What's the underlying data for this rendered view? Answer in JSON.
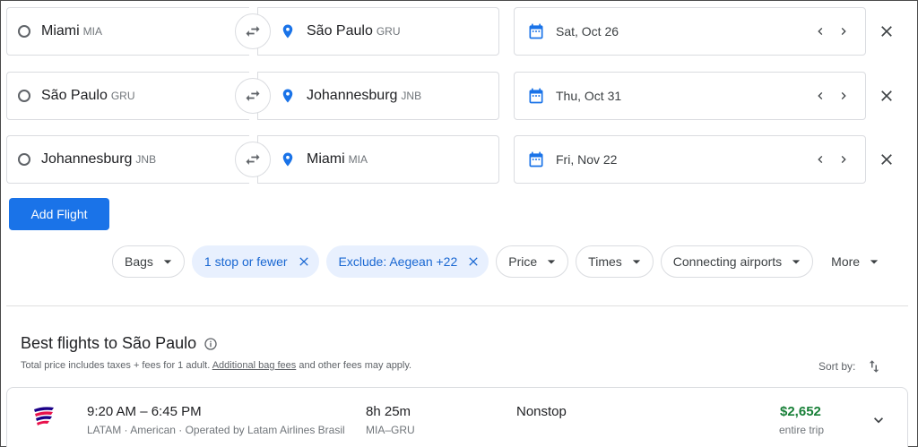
{
  "legs": [
    {
      "origin_city": "Miami",
      "origin_code": "MIA",
      "dest_city": "São Paulo",
      "dest_code": "GRU",
      "date": "Sat, Oct 26"
    },
    {
      "origin_city": "São Paulo",
      "origin_code": "GRU",
      "dest_city": "Johannesburg",
      "dest_code": "JNB",
      "date": "Thu, Oct 31"
    },
    {
      "origin_city": "Johannesburg",
      "origin_code": "JNB",
      "dest_city": "Miami",
      "dest_code": "MIA",
      "date": "Fri, Nov 22"
    }
  ],
  "add_flight_label": "Add Flight",
  "filters": {
    "bags": "Bags",
    "stops": "1 stop or fewer",
    "exclude": "Exclude: Aegean +22",
    "price": "Price",
    "times": "Times",
    "connecting": "Connecting airports",
    "more": "More"
  },
  "results": {
    "title": "Best flights to São Paulo",
    "note_prefix": "Total price includes taxes + fees for 1 adult. ",
    "note_link": "Additional bag fees",
    "note_suffix": " and other fees may apply.",
    "sort_label": "Sort by:"
  },
  "flight": {
    "times": "9:20 AM – 6:45 PM",
    "airline": "LATAM · American · Operated by Latam Airlines Brasil",
    "duration": "8h 25m",
    "route": "MIA–GRU",
    "stops": "Nonstop",
    "price": "$2,652",
    "price_note": "entire trip"
  },
  "colors": {
    "accent": "#1a73e8",
    "chip_active_bg": "#e8f0fe",
    "chip_active_text": "#1967d2",
    "price_green": "#188038"
  }
}
